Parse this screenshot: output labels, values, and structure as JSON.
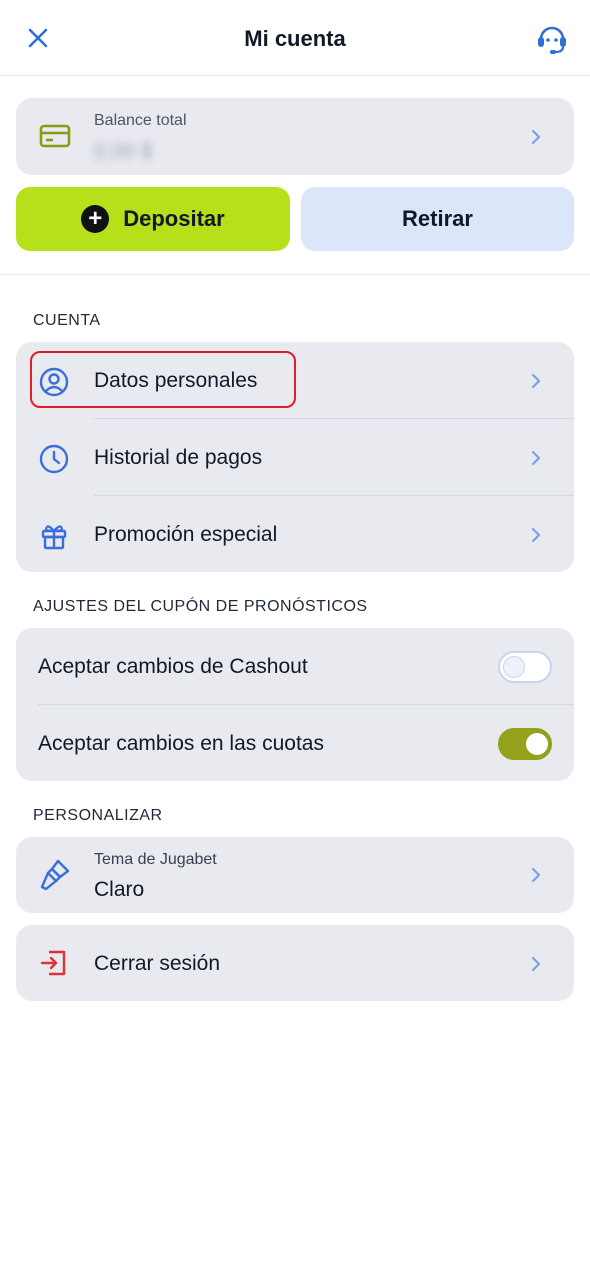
{
  "header": {
    "title": "Mi cuenta"
  },
  "balance": {
    "label": "Balance total",
    "amount": "0,00 $"
  },
  "actions": {
    "deposit_label": "Depositar",
    "withdraw_label": "Retirar"
  },
  "sections": {
    "account": {
      "title": "CUENTA",
      "items": [
        {
          "label": "Datos personales",
          "icon": "user-circle-icon"
        },
        {
          "label": "Historial de pagos",
          "icon": "clock-icon"
        },
        {
          "label": "Promoción especial",
          "icon": "gift-icon"
        }
      ]
    },
    "coupon": {
      "title": "AJUSTES DEL CUPÓN DE PRONÓSTICOS",
      "items": [
        {
          "label": "Aceptar cambios de Cashout",
          "enabled": false
        },
        {
          "label": "Aceptar cambios en las cuotas",
          "enabled": true
        }
      ]
    },
    "personalize": {
      "title": "PERSONALIZAR",
      "theme": {
        "label": "Tema de Jugabet",
        "value": "Claro"
      }
    }
  },
  "logout": {
    "label": "Cerrar sesión"
  },
  "colors": {
    "accent_green": "#b6e01a",
    "icon_blue": "#3a6fd8",
    "toggle_on": "#93a11d",
    "logout_red": "#e0313b",
    "highlight_red": "#e11d2a"
  }
}
